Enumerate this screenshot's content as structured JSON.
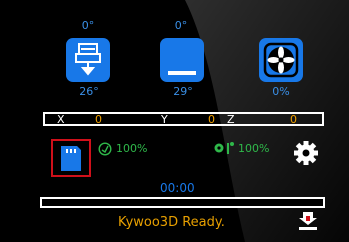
{
  "temps": {
    "extruder_target": "0°",
    "extruder_current": "26°",
    "bed_target": "0°",
    "bed_current": "29°",
    "fan_speed": "0%"
  },
  "coords": {
    "x_label": "X",
    "x_value": "0",
    "y_label": "Y",
    "y_value": "0",
    "z_label": "Z",
    "z_value": "0"
  },
  "print_info": {
    "speed": "100%",
    "flow": "100%",
    "time": "00:00",
    "progress": 0
  },
  "status_message": "Kywoo3D Ready.",
  "colors": {
    "accent_blue": "#1878e8",
    "value_orange": "#f0a000",
    "status_orange": "#e8a000",
    "green": "#2fb84a",
    "selection_red": "#d0101a"
  },
  "icons": {
    "extruder": "extruder-icon",
    "bed": "heatbed-icon",
    "fan": "fan-icon",
    "sd_card": "sd-card-icon",
    "speed": "speed-gauge-icon",
    "flow": "flow-icon",
    "settings": "gear-icon",
    "home": "home-icon"
  }
}
